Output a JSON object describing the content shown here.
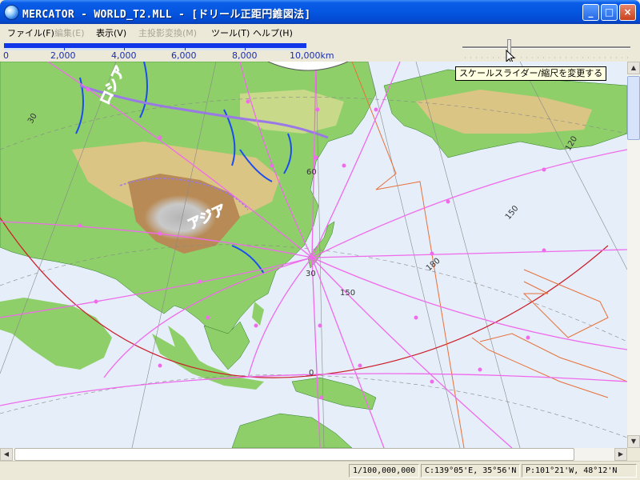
{
  "window": {
    "title": "MERCATOR - WORLD_T2.MLL - [ドリール正距円錐図法]",
    "icon": "globe-icon",
    "controls": {
      "minimize": "_",
      "maximize": "□",
      "close": "×"
    }
  },
  "menu": [
    {
      "label": "ファイル(F)",
      "enabled": true
    },
    {
      "label": "編集(E)",
      "enabled": false
    },
    {
      "label": "表示(V)",
      "enabled": true
    },
    {
      "label": "主投影変換(M)",
      "enabled": false
    },
    {
      "label": "ツール(T)",
      "enabled": true
    },
    {
      "label": "ヘルプ(H)",
      "enabled": true
    }
  ],
  "scale_bar": {
    "labels": [
      "0",
      "2,000",
      "4,000",
      "6,000",
      "8,000",
      "10,000km"
    ],
    "color": "#1137e8"
  },
  "scale_slider": {
    "tooltip": "スケールスライダー/縮尺を変更する",
    "position": 0.27
  },
  "map": {
    "projection": "ドリール正距円錐図法",
    "grid_labels": [
      "30",
      "60",
      "120",
      "150",
      "30",
      "150",
      "0",
      "30",
      "120",
      "180"
    ],
    "region_labels": [
      "アジア",
      "ロシア"
    ],
    "colors": {
      "ocean": "#e5eef9",
      "lowland": "#8ecf6a",
      "highland": "#dbc584",
      "mountain": "#b88b56",
      "ice": "#c4c4c4",
      "rivers": "#1a4df0",
      "border": "#9a78e6",
      "route": "#f06aec",
      "circle": "#cc1e2a",
      "grid": "#888888",
      "zone": "#e8703a"
    }
  },
  "status": {
    "scale": "1/100,000,000",
    "center": "C:139°05'E, 35°56'N",
    "pointer": "P:101°21'W, 48°12'N"
  }
}
